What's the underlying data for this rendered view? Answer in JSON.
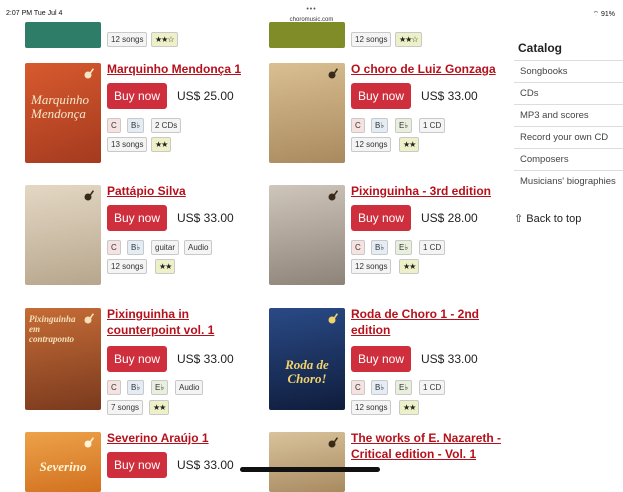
{
  "status_bar": {
    "time": "2:07 PM  Tue Jul 4",
    "url": "choromusic.com",
    "dots": "•••",
    "battery": "91%"
  },
  "products": [
    {
      "id": "top-left",
      "title": "",
      "price": "",
      "buy_label": "",
      "tags": [
        "12 songs"
      ],
      "stars": "★★☆",
      "cover_color": "#2e7d68"
    },
    {
      "id": "top-right",
      "title": "",
      "price": "",
      "buy_label": "",
      "tags": [
        "12 songs"
      ],
      "stars": "★★☆",
      "cover_color": "#7f8c27"
    },
    {
      "id": "marquinho",
      "title": "Marquinho Mendonça 1",
      "buy_label": "Buy now",
      "price": "US$ 25.00",
      "tags": [
        "C",
        "B♭",
        "2 CDs",
        "13 songs"
      ],
      "stars": "★★",
      "cover_label": "Marquinho Mendonça",
      "cover_color": "#c94e2a"
    },
    {
      "id": "gonzaga",
      "title": "O choro de Luiz Gonzaga",
      "buy_label": "Buy now",
      "price": "US$ 33.00",
      "tags": [
        "C",
        "B♭",
        "E♭",
        "1 CD",
        "12 songs"
      ],
      "stars": "★★",
      "cover_color": "#c8a77c"
    },
    {
      "id": "pattapio",
      "title": "Pattápio Silva",
      "buy_label": "Buy now",
      "price": "US$ 33.00",
      "tags": [
        "C",
        "B♭",
        "guitar",
        "Audio",
        "12 songs"
      ],
      "stars": "★★",
      "cover_color": "#d6c7b0"
    },
    {
      "id": "pixinguinha3",
      "title": "Pixinguinha - 3rd edition",
      "buy_label": "Buy now",
      "price": "US$ 28.00",
      "tags": [
        "C",
        "B♭",
        "E♭",
        "1 CD",
        "12 songs"
      ],
      "stars": "★★",
      "cover_color": "#b9aea3"
    },
    {
      "id": "counterpoint",
      "title": "Pixinguinha in counterpoint vol. 1",
      "title_lines": [
        "Pixinguinha in",
        "counterpoint vol. 1"
      ],
      "buy_label": "Buy now",
      "price": "US$ 33.00",
      "tags": [
        "C",
        "B♭",
        "E♭",
        "Audio",
        "7 songs"
      ],
      "stars": "★★",
      "cover_label": "Pixinguinha em contraponto",
      "cover_color": "#a5532c"
    },
    {
      "id": "roda1",
      "title": "Roda de Choro 1 - 2nd edition",
      "title_lines": [
        "Roda de Choro 1 - 2nd",
        "edition"
      ],
      "buy_label": "Buy now",
      "price": "US$ 33.00",
      "tags": [
        "C",
        "B♭",
        "E♭",
        "1 CD",
        "12 songs"
      ],
      "stars": "★★",
      "cover_label": "Roda de Choro!",
      "cover_color": "#1d2f5a"
    },
    {
      "id": "severino",
      "title": "Severino Araújo 1",
      "buy_label": "Buy now",
      "price": "US$ 33.00",
      "tags": [],
      "stars": "",
      "cover_label": "Severino",
      "cover_color": "#e3892e"
    },
    {
      "id": "nazareth",
      "title": "The works of E. Nazareth - Critical edition - Vol. 1",
      "title_lines": [
        "The works of E. Nazareth -",
        "Critical edition - Vol. 1"
      ],
      "buy_label": "",
      "price": "",
      "tags": [],
      "stars": "",
      "cover_color": "#c9b48e"
    }
  ],
  "sidebar": {
    "title": "Catalog",
    "items": [
      "Songbooks",
      "CDs",
      "MP3 and scores",
      "Record your own CD",
      "Composers",
      "Musicians' biographies"
    ]
  },
  "back_to_top": "Back to top",
  "colors": {
    "accent": "#b5111b",
    "button": "#cf2f3d"
  }
}
